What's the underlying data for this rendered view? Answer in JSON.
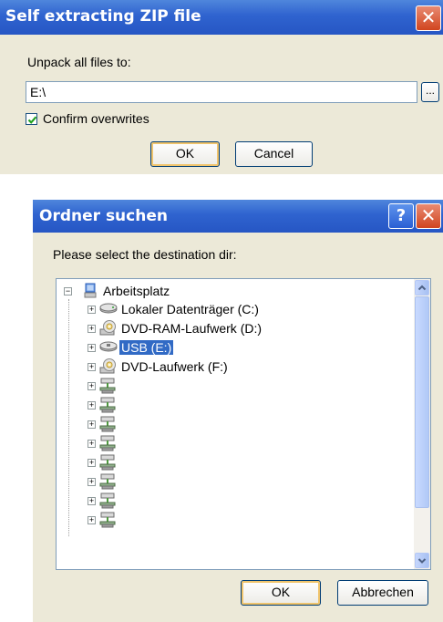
{
  "zip_dialog": {
    "title": "Self extracting ZIP file",
    "close_glyph": "✕",
    "unpack_label": "Unpack all files to:",
    "path_value": "E:\\",
    "browse_label": "...",
    "confirm_overwrites_label": "Confirm overwrites",
    "confirm_overwrites_checked": true,
    "ok_label": "OK",
    "cancel_label": "Cancel"
  },
  "folder_dialog": {
    "title": "Ordner suchen",
    "help_glyph": "?",
    "close_glyph": "✕",
    "prompt": "Please select the destination dir:",
    "tree": {
      "root": {
        "label": "Arbeitsplatz",
        "icon": "computer-icon",
        "expander": "−"
      },
      "items": [
        {
          "label": "Lokaler Datenträger (C:)",
          "icon": "hard-drive-icon",
          "expander": "+"
        },
        {
          "label": "DVD-RAM-Laufwerk (D:)",
          "icon": "dvd-drive-icon",
          "expander": "+"
        },
        {
          "label": "USB (E:)",
          "icon": "usb-drive-icon",
          "expander": "+",
          "selected": true
        },
        {
          "label": "DVD-Laufwerk (F:)",
          "icon": "dvd-drive-icon",
          "expander": "+"
        },
        {
          "label": "",
          "icon": "network-drive-icon",
          "expander": "+"
        },
        {
          "label": "",
          "icon": "network-drive-icon",
          "expander": "+"
        },
        {
          "label": "",
          "icon": "network-drive-icon",
          "expander": "+"
        },
        {
          "label": "",
          "icon": "network-drive-icon",
          "expander": "+"
        },
        {
          "label": "",
          "icon": "network-drive-icon",
          "expander": "+"
        },
        {
          "label": "",
          "icon": "network-drive-icon",
          "expander": "+"
        },
        {
          "label": "",
          "icon": "network-drive-icon",
          "expander": "+"
        },
        {
          "label": "",
          "icon": "network-drive-icon",
          "expander": "+"
        }
      ]
    },
    "ok_label": "OK",
    "cancel_label": "Abbrechen"
  },
  "colors": {
    "titlebar": "#2f63cf",
    "dialog_bg": "#ece9d8",
    "selection": "#316ac5",
    "close_red": "#d1451f"
  }
}
